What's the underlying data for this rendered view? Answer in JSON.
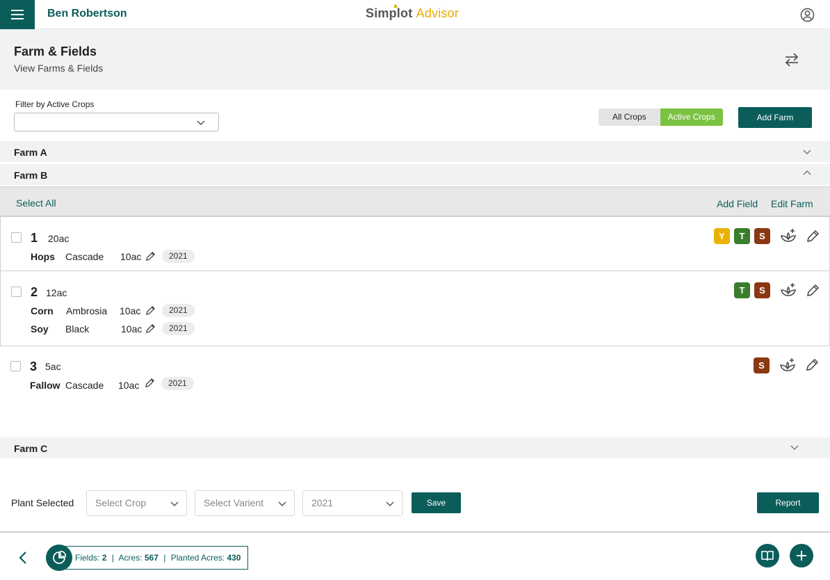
{
  "header": {
    "user_name": "Ben Robertson",
    "logo_part1": "Simplot",
    "logo_part2": "Advisor"
  },
  "page": {
    "title": "Farm & Fields",
    "subtitle": "View Farms & Fields"
  },
  "filter": {
    "label": "Filter by Active Crops",
    "value": ""
  },
  "crop_toggle": {
    "options": [
      "All Crops",
      "Active Crops"
    ],
    "selected": "Active Crops"
  },
  "buttons": {
    "add_farm": "Add Farm",
    "select_all": "Select All",
    "add_field": "Add Field",
    "edit_farm": "Edit Farm",
    "save": "Save",
    "report": "Report"
  },
  "farms": [
    {
      "name": "Farm A",
      "expanded": false
    },
    {
      "name": "Farm B",
      "expanded": true
    },
    {
      "name": "Farm C",
      "expanded": false
    }
  ],
  "fields": [
    {
      "number": "1",
      "acres": "20ac",
      "badges": [
        "Y",
        "T",
        "S"
      ],
      "crops": [
        {
          "crop": "Hops",
          "variety": "Cascade",
          "acres": "10ac",
          "year": "2021"
        }
      ]
    },
    {
      "number": "2",
      "acres": "12ac",
      "badges": [
        "T",
        "S"
      ],
      "crops": [
        {
          "crop": "Corn",
          "variety": "Ambrosia",
          "acres": "10ac",
          "year": "2021"
        },
        {
          "crop": "Soy",
          "variety": "Black",
          "acres": "10ac",
          "year": "2021"
        }
      ]
    },
    {
      "number": "3",
      "acres": "5ac",
      "badges": [
        "S"
      ],
      "crops": [
        {
          "crop": "Fallow",
          "variety": "Cascade",
          "acres": "10ac",
          "year": "2021"
        }
      ]
    }
  ],
  "plant_selected": {
    "label": "Plant Selected",
    "crop_placeholder": "Select Crop",
    "variety_placeholder": "Select Varient",
    "year_value": "2021"
  },
  "stats": {
    "fields_label": "Fields:",
    "fields_value": "2",
    "acres_label": "Acres:",
    "acres_value": "567",
    "planted_label": "Planted Acres:",
    "planted_value": "430"
  },
  "colors": {
    "brand_teal": "#0b5d5a",
    "active_green": "#7cc242",
    "badge_yellow": "#e9b100",
    "badge_green": "#3a7d2c",
    "badge_brown": "#8a3812"
  },
  "icons": [
    "menu-icon",
    "account-icon",
    "swap-icon",
    "chevron-down-icon",
    "chevron-up-icon",
    "pencil-icon",
    "plant-add-icon",
    "edit-icon",
    "back-icon",
    "pie-chart-icon",
    "book-icon",
    "plus-icon"
  ]
}
